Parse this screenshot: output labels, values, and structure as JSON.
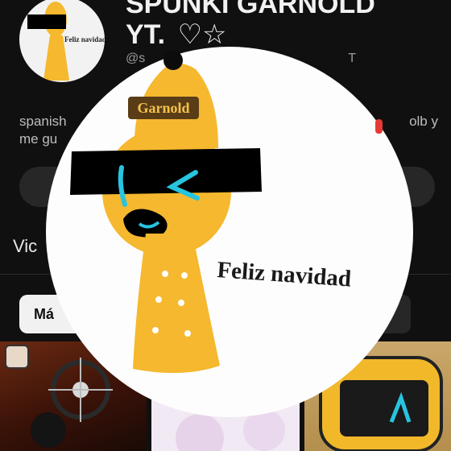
{
  "channel": {
    "title_line1": "SPUNKI GARNOLD",
    "title_line2": "YT.",
    "title_symbols": "♡☆",
    "handle_prefix": "@s",
    "handle_suffix": "T",
    "bio_left_1": "spanish",
    "bio_right_1": "olb y",
    "bio_left_2": "me gu"
  },
  "tabs": {
    "videos_partial": "Vic"
  },
  "filters": {
    "more_partial": "Má"
  },
  "drawing": {
    "hat_label": "Garnold",
    "caption": "Feliz navidad",
    "face_text": "l<",
    "small_caption": "Feliz navidad"
  },
  "colors": {
    "background": "#101010",
    "drawing_yellow": "#f5b82e",
    "visor_black": "#000000",
    "eye_cyan": "#27c4e0",
    "label_bg": "#5a3d17",
    "label_text": "#f5c34a"
  }
}
